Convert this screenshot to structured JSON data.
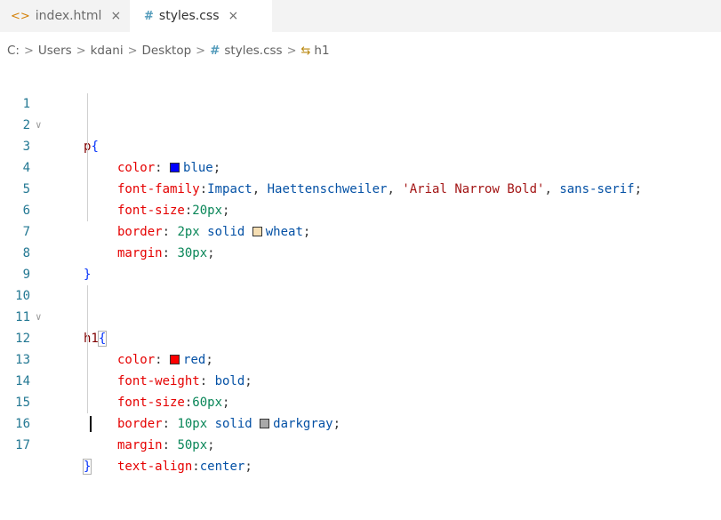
{
  "tabs": [
    {
      "icon": "<>",
      "label": "index.html",
      "close": "×",
      "active": false
    },
    {
      "icon": "#",
      "label": "styles.css",
      "close": "×",
      "active": true
    }
  ],
  "breadcrumb": {
    "path": [
      "C:",
      "Users",
      "kdani",
      "Desktop"
    ],
    "file_icon": "#",
    "file": "styles.css",
    "symbol_icon": "⇆",
    "symbol": "h1",
    "separator": ">"
  },
  "code": {
    "l1": {
      "num": "1",
      "sel": "p",
      "open": "{"
    },
    "l2": {
      "num": "2",
      "prop": "color",
      "colon": ": ",
      "val": "blue",
      "semi": ";"
    },
    "l3": {
      "num": "3",
      "prop": "font-family",
      "colon": ":",
      "v1": "Impact",
      "c1": ", ",
      "v2": "Haettenschweiler",
      "c2": ", ",
      "s1": "'Arial Narrow Bold'",
      "c3": ", ",
      "v3": "sans-serif",
      "semi": ";"
    },
    "l4": {
      "num": "4",
      "prop": "font-size",
      "colon": ":",
      "numval": "20px",
      "semi": ";"
    },
    "l5": {
      "num": "5",
      "prop": "border",
      "colon": ": ",
      "numval": "2px",
      "kw": " solid ",
      "val": "wheat",
      "semi": ";"
    },
    "l6": {
      "num": "6",
      "prop": "margin",
      "colon": ": ",
      "numval": "30px",
      "semi": ";"
    },
    "l7": {
      "num": "7"
    },
    "l8": {
      "num": "8",
      "close": "}"
    },
    "l9": {
      "num": "9"
    },
    "l10": {
      "num": "10",
      "sel": "h1",
      "open": "{"
    },
    "l11": {
      "num": "11",
      "prop": "color",
      "colon": ": ",
      "val": "red",
      "semi": ";"
    },
    "l12": {
      "num": "12",
      "prop": "font-weight",
      "colon": ": ",
      "val": "bold",
      "semi": ";"
    },
    "l13": {
      "num": "13",
      "prop": "font-size",
      "colon": ":",
      "numval": "60px",
      "semi": ";"
    },
    "l14": {
      "num": "14",
      "prop": "border",
      "colon": ": ",
      "numval": "10px",
      "kw": " solid ",
      "val": "darkgray",
      "semi": ";"
    },
    "l15": {
      "num": "15",
      "prop": "margin",
      "colon": ": ",
      "numval": "50px",
      "semi": ";"
    },
    "l16": {
      "num": "16",
      "prop": "text-align",
      "colon": ":",
      "val": "center",
      "semi": ";"
    },
    "l17": {
      "num": "17",
      "close": "}"
    }
  },
  "swatches": {
    "blue": "#0000ff",
    "wheat": "#f5deb3",
    "red": "#ff0000",
    "darkgray": "#a9a9a9"
  },
  "fold_glyph": "∨"
}
